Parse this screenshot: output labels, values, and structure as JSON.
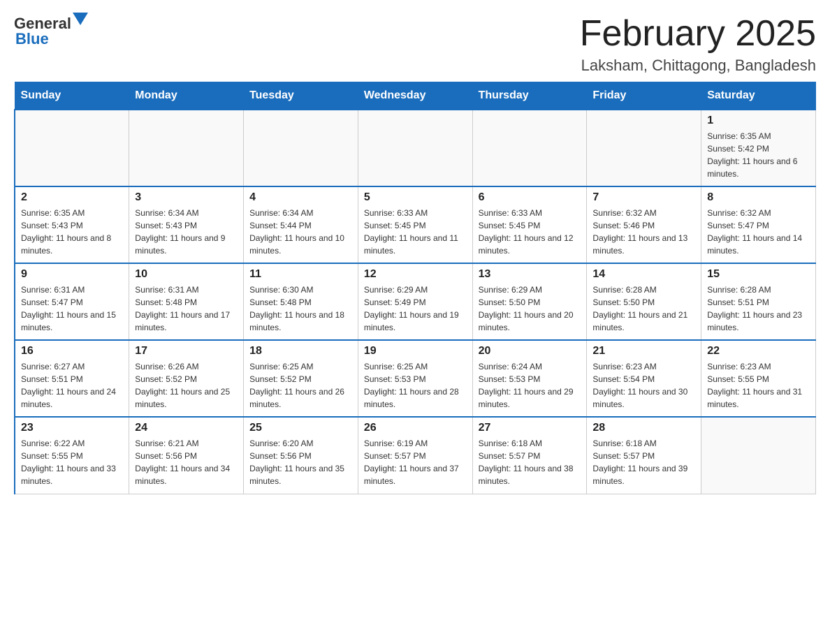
{
  "header": {
    "logo_general": "General",
    "logo_blue": "Blue",
    "month_title": "February 2025",
    "location": "Laksham, Chittagong, Bangladesh"
  },
  "days_of_week": [
    "Sunday",
    "Monday",
    "Tuesday",
    "Wednesday",
    "Thursday",
    "Friday",
    "Saturday"
  ],
  "weeks": [
    {
      "days": [
        {
          "number": "",
          "info": ""
        },
        {
          "number": "",
          "info": ""
        },
        {
          "number": "",
          "info": ""
        },
        {
          "number": "",
          "info": ""
        },
        {
          "number": "",
          "info": ""
        },
        {
          "number": "",
          "info": ""
        },
        {
          "number": "1",
          "info": "Sunrise: 6:35 AM\nSunset: 5:42 PM\nDaylight: 11 hours and 6 minutes."
        }
      ]
    },
    {
      "days": [
        {
          "number": "2",
          "info": "Sunrise: 6:35 AM\nSunset: 5:43 PM\nDaylight: 11 hours and 8 minutes."
        },
        {
          "number": "3",
          "info": "Sunrise: 6:34 AM\nSunset: 5:43 PM\nDaylight: 11 hours and 9 minutes."
        },
        {
          "number": "4",
          "info": "Sunrise: 6:34 AM\nSunset: 5:44 PM\nDaylight: 11 hours and 10 minutes."
        },
        {
          "number": "5",
          "info": "Sunrise: 6:33 AM\nSunset: 5:45 PM\nDaylight: 11 hours and 11 minutes."
        },
        {
          "number": "6",
          "info": "Sunrise: 6:33 AM\nSunset: 5:45 PM\nDaylight: 11 hours and 12 minutes."
        },
        {
          "number": "7",
          "info": "Sunrise: 6:32 AM\nSunset: 5:46 PM\nDaylight: 11 hours and 13 minutes."
        },
        {
          "number": "8",
          "info": "Sunrise: 6:32 AM\nSunset: 5:47 PM\nDaylight: 11 hours and 14 minutes."
        }
      ]
    },
    {
      "days": [
        {
          "number": "9",
          "info": "Sunrise: 6:31 AM\nSunset: 5:47 PM\nDaylight: 11 hours and 15 minutes."
        },
        {
          "number": "10",
          "info": "Sunrise: 6:31 AM\nSunset: 5:48 PM\nDaylight: 11 hours and 17 minutes."
        },
        {
          "number": "11",
          "info": "Sunrise: 6:30 AM\nSunset: 5:48 PM\nDaylight: 11 hours and 18 minutes."
        },
        {
          "number": "12",
          "info": "Sunrise: 6:29 AM\nSunset: 5:49 PM\nDaylight: 11 hours and 19 minutes."
        },
        {
          "number": "13",
          "info": "Sunrise: 6:29 AM\nSunset: 5:50 PM\nDaylight: 11 hours and 20 minutes."
        },
        {
          "number": "14",
          "info": "Sunrise: 6:28 AM\nSunset: 5:50 PM\nDaylight: 11 hours and 21 minutes."
        },
        {
          "number": "15",
          "info": "Sunrise: 6:28 AM\nSunset: 5:51 PM\nDaylight: 11 hours and 23 minutes."
        }
      ]
    },
    {
      "days": [
        {
          "number": "16",
          "info": "Sunrise: 6:27 AM\nSunset: 5:51 PM\nDaylight: 11 hours and 24 minutes."
        },
        {
          "number": "17",
          "info": "Sunrise: 6:26 AM\nSunset: 5:52 PM\nDaylight: 11 hours and 25 minutes."
        },
        {
          "number": "18",
          "info": "Sunrise: 6:25 AM\nSunset: 5:52 PM\nDaylight: 11 hours and 26 minutes."
        },
        {
          "number": "19",
          "info": "Sunrise: 6:25 AM\nSunset: 5:53 PM\nDaylight: 11 hours and 28 minutes."
        },
        {
          "number": "20",
          "info": "Sunrise: 6:24 AM\nSunset: 5:53 PM\nDaylight: 11 hours and 29 minutes."
        },
        {
          "number": "21",
          "info": "Sunrise: 6:23 AM\nSunset: 5:54 PM\nDaylight: 11 hours and 30 minutes."
        },
        {
          "number": "22",
          "info": "Sunrise: 6:23 AM\nSunset: 5:55 PM\nDaylight: 11 hours and 31 minutes."
        }
      ]
    },
    {
      "days": [
        {
          "number": "23",
          "info": "Sunrise: 6:22 AM\nSunset: 5:55 PM\nDaylight: 11 hours and 33 minutes."
        },
        {
          "number": "24",
          "info": "Sunrise: 6:21 AM\nSunset: 5:56 PM\nDaylight: 11 hours and 34 minutes."
        },
        {
          "number": "25",
          "info": "Sunrise: 6:20 AM\nSunset: 5:56 PM\nDaylight: 11 hours and 35 minutes."
        },
        {
          "number": "26",
          "info": "Sunrise: 6:19 AM\nSunset: 5:57 PM\nDaylight: 11 hours and 37 minutes."
        },
        {
          "number": "27",
          "info": "Sunrise: 6:18 AM\nSunset: 5:57 PM\nDaylight: 11 hours and 38 minutes."
        },
        {
          "number": "28",
          "info": "Sunrise: 6:18 AM\nSunset: 5:57 PM\nDaylight: 11 hours and 39 minutes."
        },
        {
          "number": "",
          "info": ""
        }
      ]
    }
  ]
}
